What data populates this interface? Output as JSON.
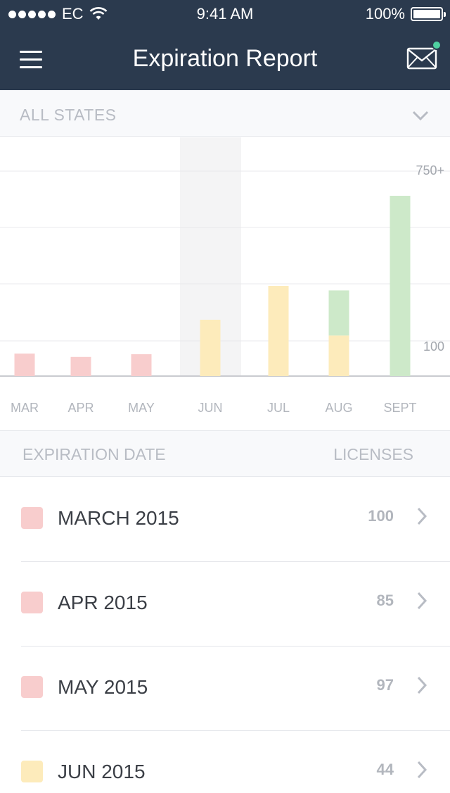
{
  "status_bar": {
    "carrier": "EC",
    "time": "9:41 AM",
    "battery": "100%"
  },
  "nav": {
    "title": "Expiration Report",
    "menu_icon": "hamburger-icon",
    "mail_icon": "envelope-icon",
    "notification_color": "#4fd1a1"
  },
  "filter": {
    "label": "ALL STATES"
  },
  "chart_data": {
    "type": "bar",
    "stacked": true,
    "categories": [
      "MAR",
      "APR",
      "MAY",
      "JUN",
      "JUL",
      "AUG",
      "SEPT"
    ],
    "highlighted_category": "JUN",
    "series": [
      {
        "color": "#f8cdcd",
        "values": [
          100,
          85,
          97,
          0,
          0,
          0,
          0
        ]
      },
      {
        "color": "#fdebbb",
        "values": [
          0,
          0,
          0,
          250,
          400,
          180,
          0
        ]
      },
      {
        "color": "#cde9c9",
        "values": [
          0,
          0,
          0,
          0,
          0,
          200,
          800
        ]
      }
    ],
    "y_tick_labels": [
      "750+",
      "100"
    ],
    "grid": true
  },
  "list": {
    "headers": {
      "date": "EXPIRATION DATE",
      "licenses": "LICENSES"
    },
    "rows": [
      {
        "date": "MARCH 2015",
        "count": "100",
        "color": "#f8cdcd"
      },
      {
        "date": "APR 2015",
        "count": "85",
        "color": "#f8cdcd"
      },
      {
        "date": "MAY 2015",
        "count": "97",
        "color": "#f8cdcd"
      },
      {
        "date": "JUN 2015",
        "count": "44",
        "color": "#fdebbb"
      }
    ]
  }
}
